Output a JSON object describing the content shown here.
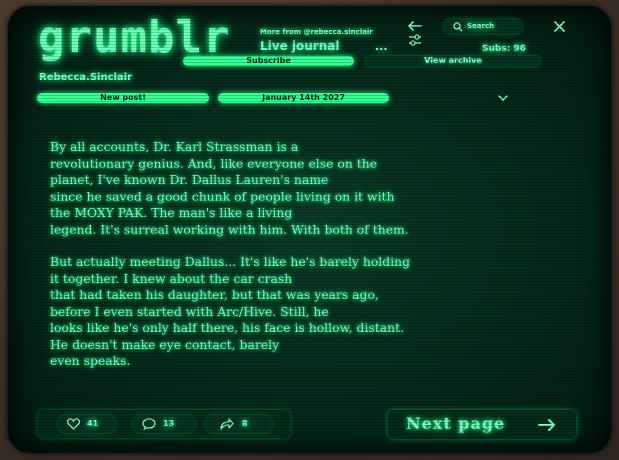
{
  "header": {
    "logo": "grumblr",
    "more_from": "More from @rebecca.sinclair",
    "journal_title": "Live journal",
    "more_dots": "...",
    "search_label": "Search",
    "subs": "Subs: 96",
    "subscribe_label": "Subscribe",
    "view_archive_label": "View archive",
    "username": "Rebecca.Sinclair"
  },
  "post_bar": {
    "new_post_label": "New post!",
    "date": "January 14th 2027"
  },
  "post": {
    "paragraphs": [
      [
        "By all accounts, Dr. Karl Strassman is a",
        "revolutionary genius. And, like everyone else on the",
        "planet, I've known Dr. Dallus Lauren's name",
        "since he saved a good chunk of people living on it with",
        "the MOXY PAK. The man's like a living",
        "legend. It's surreal working with him. With both of them."
      ],
      [
        "But actually meeting Dallus... It's like he's barely holding",
        "it together. I knew about the car crash",
        "that had taken his daughter, but that was years ago,",
        "before I even started with Arc/Hive. Still, he",
        "looks like he's only half there, his face is hollow, distant.",
        "He doesn't make eye contact, barely",
        "even speaks."
      ]
    ]
  },
  "footer": {
    "likes": "41",
    "comments": "13",
    "shares": "8",
    "next_page_label": "Next page"
  },
  "icons": {
    "back": "arrow-left-icon",
    "settings": "sliders-icon",
    "search": "search-icon",
    "close": "close-icon",
    "dropdown": "chevron-down-icon",
    "like": "heart-icon",
    "comment": "comment-icon",
    "share": "share-icon",
    "next": "arrow-right-icon"
  },
  "colors": {
    "accent": "#33ff95",
    "text": "#7dffc0",
    "screen_bg": "#052a1b"
  }
}
